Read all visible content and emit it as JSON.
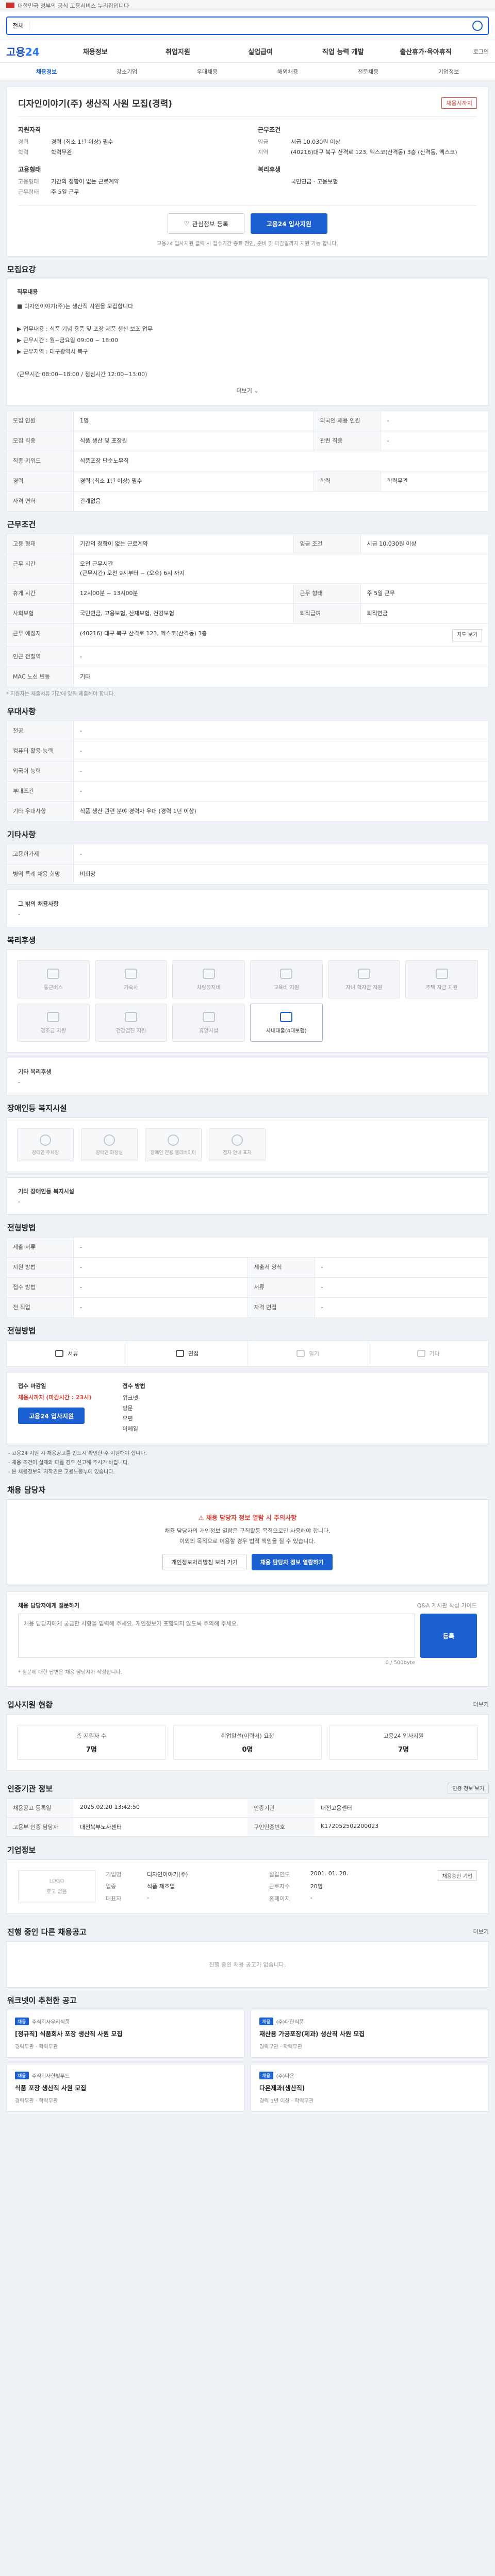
{
  "topbar": {
    "text": "대한민국 정부의 공식 고용서비스 누리집입니다"
  },
  "search": {
    "type_label": "전체",
    "placeholder": ""
  },
  "nav": {
    "logo_a": "고용",
    "logo_b": "24",
    "items": [
      "채용정보",
      "취업지원",
      "실업급여",
      "직업 능력 개발",
      "출산휴가·육아휴직"
    ],
    "login": "로그인"
  },
  "subnav": [
    "채용정보",
    "강소기업",
    "우대채용",
    "해외채용",
    "전문채용",
    "기업정보"
  ],
  "job": {
    "title": "디자인이야기(주) 생산직 사원 모집(경력)",
    "badge": "채용시까지",
    "left_group_title": "지원자격",
    "left_kv": [
      {
        "k": "경력",
        "v": "경력 (최소 1년 이상) 필수"
      },
      {
        "k": "학력",
        "v": "학력무관"
      }
    ],
    "left_group2_title": "고용형태",
    "left_kv2": [
      {
        "k": "고용형태",
        "v": "기간의 정함이 없는 근로계약"
      },
      {
        "k": "근무형태",
        "v": "주 5일 근무"
      }
    ],
    "right_group_title": "근무조건",
    "right_kv": [
      {
        "k": "임금",
        "v": "시급 10,030원 이상"
      },
      {
        "k": "지역",
        "v": "(40216)대구 북구 산격로 123, 엑스코(산격동) 3층 (산격동, 엑스코)"
      }
    ],
    "right_group2_title": "복리후생",
    "right_kv2": [
      {
        "k": "",
        "v": "국민연금 · 고용보험"
      }
    ],
    "actions": {
      "save": "관심정보 등록",
      "apply": "고용24 입사지원"
    },
    "note": "고용24 입사지원 클릭 시 접수기간 종료 전인, 준비 및 마감일까지 지원 가능 합니다."
  },
  "recruit_section": {
    "title": "모집요강",
    "box_title": "직무내용",
    "lines": [
      "■ 디자인이야기(주)는 생산직 사원을 모집합니다",
      "",
      "▶ 업무내용 : 식품 기념 용품 및 포장 제품 생산 보조 업무",
      "▶ 근무시간 : 월~금요일 09:00 ~ 18:00",
      "▶ 근무지역 : 대구광역시 북구",
      "",
      "(근무시간 08:00~18:00 / 점심시간 12:00~13:00)"
    ],
    "more": "더보기",
    "table": [
      {
        "k": "모집 인원",
        "v": "1명",
        "k2": "외국인 채용 인원",
        "v2": "-"
      },
      {
        "k": "모집 직종",
        "v": "식품 생산 및 포장원",
        "k2": "관련 직종",
        "v2": "-"
      },
      {
        "k": "직종 키워드",
        "v": "식품포장 단순노무직",
        "k2": "",
        "v2": ""
      },
      {
        "k": "경력",
        "v": "경력 (최소 1년 이상) 필수",
        "k2": "학력",
        "v2": "학력무관"
      },
      {
        "k": "자격 면허",
        "v": "관계없음",
        "k2": "",
        "v2": ""
      }
    ]
  },
  "conditions_section": {
    "title": "근무조건",
    "rows": [
      {
        "k": "고용 형태",
        "v": "기간의 정함이 없는 근로계약",
        "k2": "임금 조건",
        "v2": "시급 10,030원 이상"
      },
      {
        "k": "근무 시간",
        "v": "오전 근무시간\n(근무시간) 오전 9시부터 ~ (오후) 6시 까지",
        "k2": "",
        "v2": ""
      },
      {
        "k": "휴게 시간",
        "v": "12시00분 ~ 13시00분",
        "k2": "근무 형태",
        "v2": "주 5일 근무"
      },
      {
        "k": "사회보험",
        "v": "국민연금, 고용보험, 산재보험, 건강보험",
        "k2": "퇴직급여",
        "v2": "퇴직연금"
      },
      {
        "k": "근무 예정지",
        "v": "(40216) 대구 북구 산격로 123, 엑스코(산격동) 3층",
        "k2": "",
        "v2": ""
      },
      {
        "k": "인근 전철역",
        "v": "-",
        "k2": "",
        "v2": ""
      },
      {
        "k": "MAC 노선 변동",
        "v": "기타",
        "k2": "",
        "v2": ""
      }
    ],
    "map_btn": "지도 보기",
    "fine": "* 지원자는 제출서류 기간에 맞춰 제출해야 합니다."
  },
  "preference_section": {
    "title": "우대사항",
    "rows": [
      {
        "k": "전공",
        "v": "-"
      },
      {
        "k": "컴퓨터 활용 능력",
        "v": "-"
      },
      {
        "k": "외국어 능력",
        "v": "-"
      },
      {
        "k": "부대조건",
        "v": "-"
      },
      {
        "k": "기타 우대사항",
        "v": "식품 생산 관련 분야 경력자 우대 (경력 1년 이상)"
      }
    ]
  },
  "other_section": {
    "title": "기타사항",
    "rows": [
      {
        "k": "고용허가제",
        "v": "-"
      },
      {
        "k": "병역 특례 채용 희망",
        "v": "비희망"
      }
    ],
    "sub_title": "그 밖의 채용사항",
    "sub_value": "-"
  },
  "welfare_section": {
    "title": "복리후생",
    "tiles": [
      {
        "label": "통근버스",
        "on": false
      },
      {
        "label": "기숙사",
        "on": false
      },
      {
        "label": "차량유지비",
        "on": false
      },
      {
        "label": "교육비 지원",
        "on": false
      },
      {
        "label": "자녀 학자금 지원",
        "on": false
      },
      {
        "label": "주택 자금 지원",
        "on": false
      },
      {
        "label": "경조금 지원",
        "on": false
      },
      {
        "label": "건강검진 지원",
        "on": false
      },
      {
        "label": "휴양시설",
        "on": false
      },
      {
        "label": "사내대출(4대보험)",
        "on": true
      }
    ],
    "extra_label": "기타 복리후생",
    "extra_value": "-"
  },
  "disability_section": {
    "title": "장애인등 복지시설",
    "tiles": [
      "장애인 주차장",
      "장애인 화장실",
      "장애인 전용 엘리베이터",
      "점자 안내 표지"
    ],
    "extra_label": "기타 장애인등 복지시설",
    "extra_value": "-"
  },
  "selection_section": {
    "title": "전형방법",
    "rows": [
      {
        "k": "제출 서류",
        "v": "-"
      },
      {
        "k": "지원 방법",
        "v": "-",
        "k2": "제출서 양식",
        "v2": "-"
      },
      {
        "k": "접수 방법",
        "v": "-",
        "k2": "서류",
        "v2": "-"
      },
      {
        "k": "전 직업",
        "v": "-",
        "k2": "자격 면접",
        "v2": "-"
      }
    ]
  },
  "apply_section": {
    "title": "전형방법",
    "methods": [
      {
        "label": "서류",
        "off": false
      },
      {
        "label": "면접",
        "off": false
      },
      {
        "label": "필기",
        "off": true
      },
      {
        "label": "기타",
        "off": true
      }
    ],
    "deadline_title": "접수 마감일",
    "deadline_value": "채용시까지 (마감시간 : 23시)",
    "method_title": "접수 방법",
    "method_lines": [
      "워크넷",
      "방문",
      "우편",
      "이메일"
    ],
    "apply_btn": "고용24 입사지원",
    "cautions": [
      "- 고용24 지원 시 채용공고를 반드시 확인한 후 지원해야 합니다.",
      "- 채용 조건이 실제와 다를 경우 신고해 주시기 바랍니다.",
      "- 본 채용정보의 저작권은 고용노동부에 있습니다."
    ]
  },
  "contact_section": {
    "title": "채용 담당자",
    "alert": "채용 담당자 정보 열람 시 주의사항",
    "text": "채용 담당자의 개인정보 열람은 구직활동 목적으로만 사용해야 합니다.\n이외의 목적으로 이용할 경우 법적 책임을 질 수 있습니다.",
    "btn1": "개인정보처리방침 보러 가기",
    "btn2": "채용 담당자 정보 열람하기"
  },
  "qa_section": {
    "title": "채용 담당자에게 질문하기",
    "right_note": "Q&A 게시판 작성 가이드",
    "placeholder": "채용 담당자에게 궁금한 사항을 입력해 주세요. 개인정보가 포함되지 않도록 주의해 주세요.",
    "count": "0 / 500byte",
    "submit": "등록",
    "fine": "* 질문에 대한 답변은 채용 담당자가 작성합니다."
  },
  "stats_section": {
    "title": "입사지원 현황",
    "link": "더보기",
    "stats": [
      {
        "label": "총 지원자 수",
        "num": "7명"
      },
      {
        "label": "취업알선(이력서) 요청",
        "num": "0명"
      },
      {
        "label": "고용24 입사지원",
        "num": "7명"
      }
    ]
  },
  "reginfo_section": {
    "title": "인증기관 정보",
    "btn": "인증 정보 보기",
    "rows": [
      {
        "k": "채용공고 등록일",
        "v": "2025.02.20 13:42:50",
        "k2": "인증기관",
        "v2": "대전고용센터"
      },
      {
        "k": "고용부 인증 담당자",
        "v": "대전북부노사센터",
        "k2": "구인인증번호",
        "v2": "K172052502200023"
      }
    ]
  },
  "company_section": {
    "title": "기업정보",
    "logo_label": "LOGO",
    "logo_sub": "로고 없음",
    "rows": [
      {
        "k": "기업명",
        "v": "디자인이야기(주)",
        "k2": "설립연도",
        "v2": "2001. 01. 28."
      },
      {
        "k": "업종",
        "v": "식품 제조업",
        "k2": "근로자수",
        "v2": "20명"
      },
      {
        "k": "대표자",
        "v": "-",
        "k2": "홈페이지",
        "v2": "-"
      }
    ],
    "btn": "채용중인 기업"
  },
  "other_jobs_section": {
    "title": "진행 중인 다른 채용공고",
    "link": "더보기",
    "empty": "진행 중인 채용 공고가 없습니다."
  },
  "rec_section": {
    "title": "워크넷이 추천한 공고",
    "items": [
      {
        "co": "주식회사우리식품",
        "title": "[정규직] 식품회사 포장 생산직 사원 모집",
        "meta": "경력무관 · 학력무관"
      },
      {
        "co": "(주)대한식품",
        "title": "재산용 가공포장(제과) 생산직 사원 모집",
        "meta": "경력무관 · 학력무관"
      },
      {
        "co": "주식회사한빛푸드",
        "title": "식품 포장 생산직 사원 모집",
        "meta": "경력무관 · 학력무관"
      },
      {
        "co": "(주)다온",
        "title": "다온제과(생산직)",
        "meta": "경력 1년 이상 · 학력무관"
      }
    ]
  }
}
